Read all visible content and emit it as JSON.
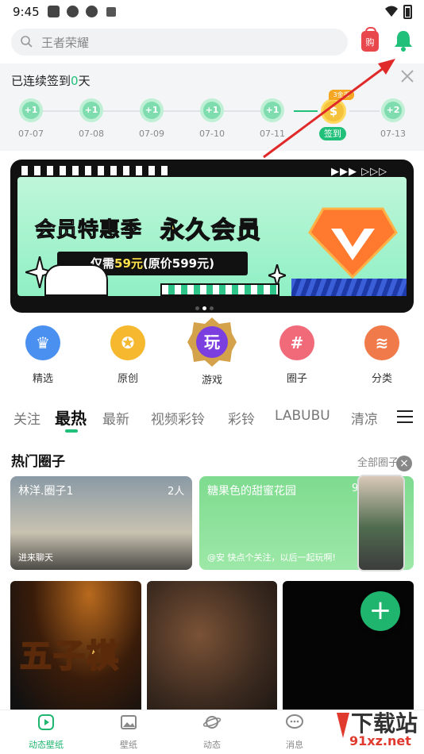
{
  "status": {
    "time": "9:45"
  },
  "search": {
    "placeholder": "王者荣耀"
  },
  "header": {
    "shop_label": "购"
  },
  "checkin": {
    "prefix": "已连续签到",
    "days": "0",
    "suffix": "天",
    "items": [
      {
        "reward": "+1",
        "date": "07-07"
      },
      {
        "reward": "+1",
        "date": "07-08"
      },
      {
        "reward": "+1",
        "date": "07-09"
      },
      {
        "reward": "+1",
        "date": "07-10"
      },
      {
        "reward": "+1",
        "date": "07-11"
      },
      {
        "reward": "$",
        "date": "签到",
        "tag": "3金币"
      },
      {
        "reward": "+2",
        "date": "07-13"
      }
    ]
  },
  "banner": {
    "line1": "会员特惠季",
    "line2": "永久会员",
    "price_prefix": "仅需",
    "price": "59元",
    "price_orig": "(原价599元)"
  },
  "categories": [
    {
      "label": "精选",
      "icon": "crown-icon",
      "color": "#4a90f0"
    },
    {
      "label": "原创",
      "icon": "medal-icon",
      "color": "#f5b82e"
    },
    {
      "label": "游戏",
      "icon": "play-badge-icon",
      "color": "#7b3fe0",
      "glyph": "玩"
    },
    {
      "label": "圈子",
      "icon": "hash-icon",
      "color": "#f06a7a"
    },
    {
      "label": "分类",
      "icon": "layers-icon",
      "color": "#f07a4a"
    }
  ],
  "tabs": [
    "关注",
    "最热",
    "最新",
    "视频彩铃",
    "彩铃",
    "LABUBU",
    "清凉"
  ],
  "hot": {
    "title": "热门圈子",
    "more": "全部圈子",
    "cards": [
      {
        "name": "林洋.圈子1",
        "count": "2人",
        "sub": "进来聊天"
      },
      {
        "name": "糖果色的甜蜜花园",
        "count": "9",
        "sub": "@安 快点个关注，以后一起玩啊!"
      }
    ]
  },
  "wallpapers": [
    {
      "title": "五子棋"
    }
  ],
  "nav": [
    {
      "label": "动态壁纸",
      "icon": "play-square-icon"
    },
    {
      "label": "壁纸",
      "icon": "image-icon"
    },
    {
      "label": "动态",
      "icon": "planet-icon"
    },
    {
      "label": "消息",
      "icon": "message-icon"
    }
  ],
  "watermark": {
    "line1": "下载站",
    "line2": "91xz.net"
  },
  "colors": {
    "accent": "#20c07a",
    "arrow": "#e02a2a"
  }
}
